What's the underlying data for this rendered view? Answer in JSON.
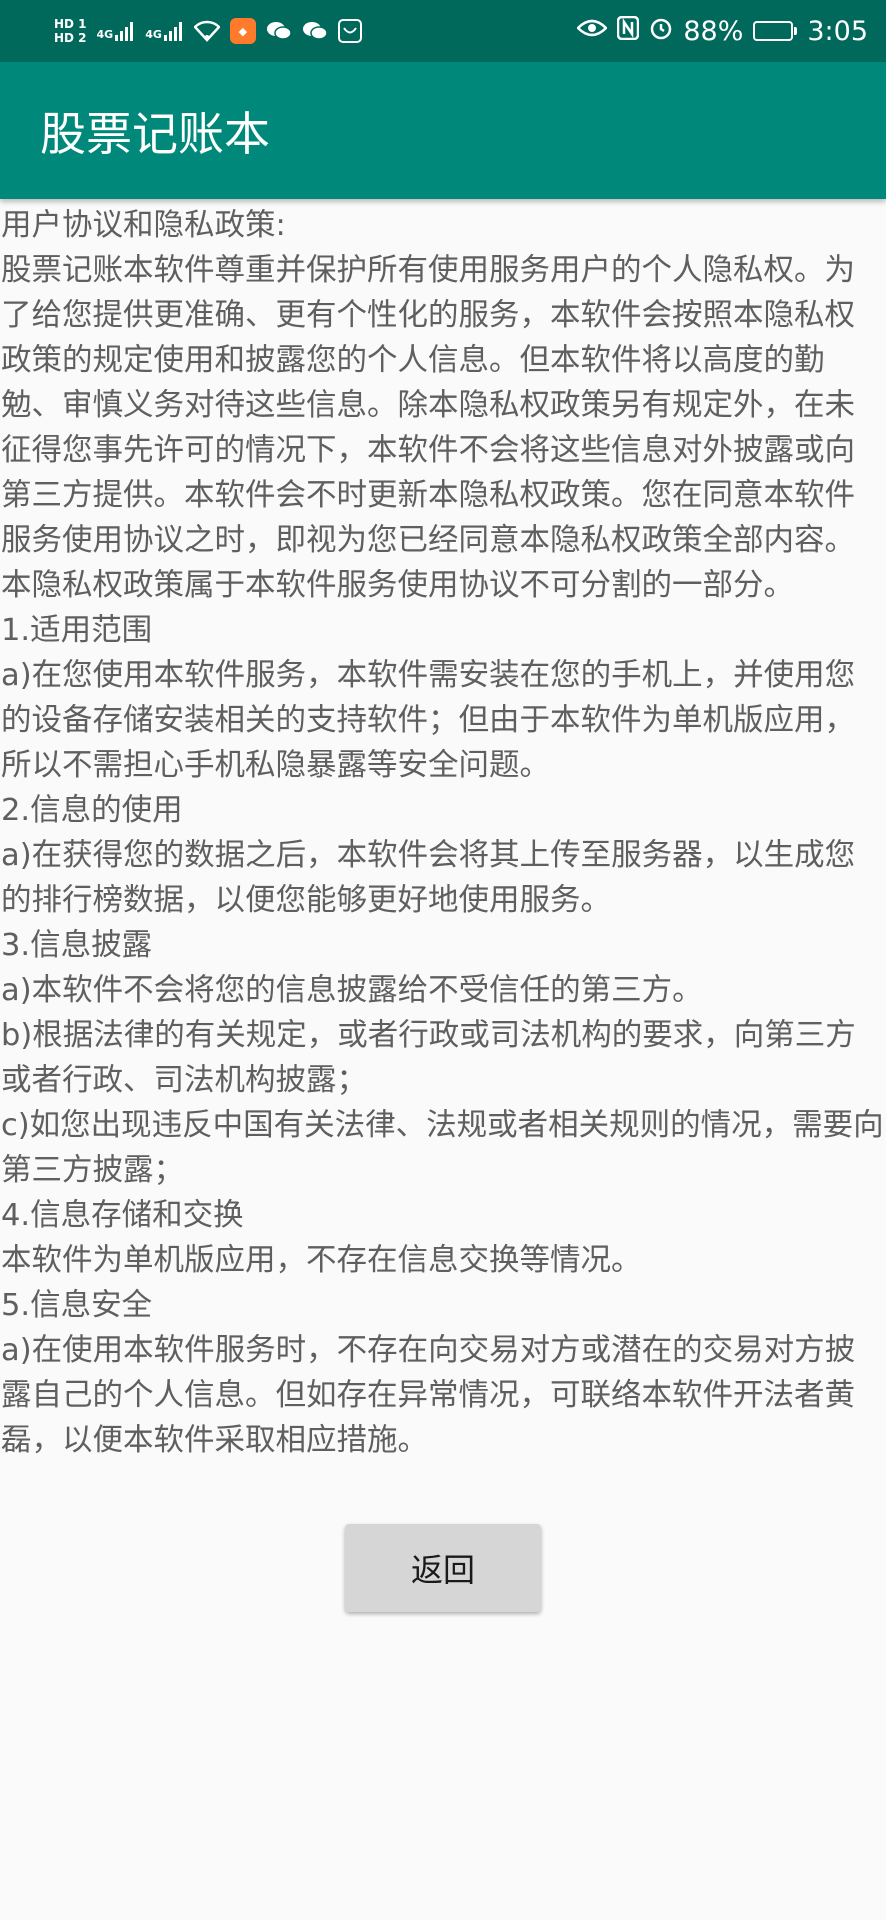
{
  "status_bar": {
    "hd_top": "HD 1",
    "hd_bottom": "HD 2",
    "sig1_label": "4G",
    "sig2_label": "4G",
    "battery_percent": "88%",
    "time": "3:05",
    "battery_level": 0.88
  },
  "app_bar": {
    "title": "股票记账本"
  },
  "content": {
    "lines": [
      "用户协议和隐私政策:",
      "股票记账本软件尊重并保护所有使用服务用户的个人隐私权。为了给您提供更准确、更有个性化的服务，本软件会按照本隐私权政策的规定使用和披露您的个人信息。但本软件将以高度的勤勉、审慎义务对待这些信息。除本隐私权政策另有规定外，在未征得您事先许可的情况下，本软件不会将这些信息对外披露或向第三方提供。本软件会不时更新本隐私权政策。您在同意本软件服务使用协议之时，即视为您已经同意本隐私权政策全部内容。本隐私权政策属于本软件服务使用协议不可分割的一部分。",
      "1.适用范围",
      "a)在您使用本软件服务，本软件需安装在您的手机上，并使用您的设备存储安装相关的支持软件；但由于本软件为单机版应用，所以不需担心手机私隐暴露等安全问题。",
      "2.信息的使用",
      "a)在获得您的数据之后，本软件会将其上传至服务器，以生成您的排行榜数据，以便您能够更好地使用服务。",
      "3.信息披露",
      "a)本软件不会将您的信息披露给不受信任的第三方。",
      "b)根据法律的有关规定，或者行政或司法机构的要求，向第三方或者行政、司法机构披露；",
      "c)如您出现违反中国有关法律、法规或者相关规则的情况，需要向第三方披露；",
      "4.信息存储和交换",
      "本软件为单机版应用，不存在信息交换等情况。",
      "5.信息安全",
      "a)在使用本软件服务时，不存在向交易对方或潜在的交易对方披露自己的个人信息。但如存在异常情况，可联络本软件开法者黄磊，以便本软件采取相应措施。"
    ]
  },
  "back_button": {
    "label": "返回"
  },
  "colors": {
    "status_bar": "#00695c",
    "app_bar": "#00897b",
    "body_text": "#5f5f5f",
    "button_bg": "#d6d6d6"
  },
  "icons": {
    "status": [
      "signal-icon",
      "wifi-icon",
      "taobao-app-icon",
      "wechat-icon",
      "wechat-icon",
      "doc-app-icon",
      "eye-icon",
      "nfc-icon",
      "alarm-icon",
      "battery-icon"
    ]
  }
}
